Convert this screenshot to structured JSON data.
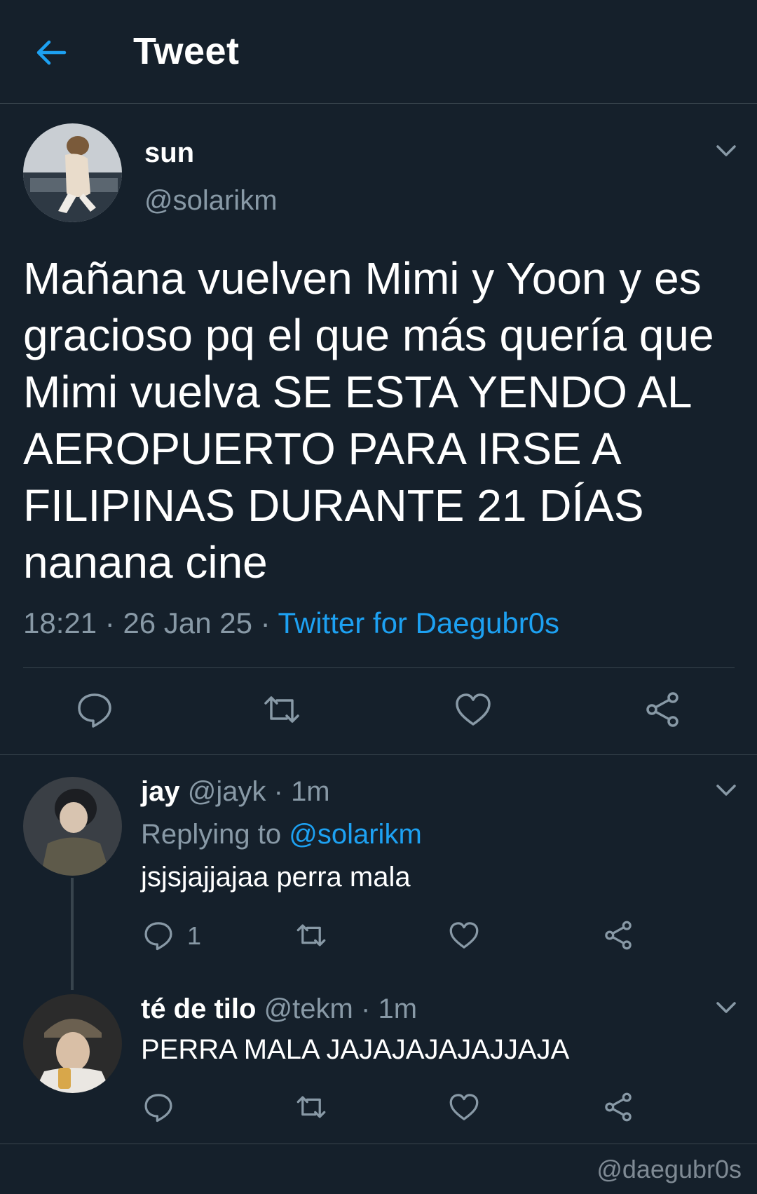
{
  "header": {
    "title": "Tweet",
    "back_icon": "arrow-left-icon"
  },
  "tweet": {
    "name": "sun",
    "handle": "@solarikm",
    "text": "Mañana vuelven Mimi y Yoon y es gracioso pq el que más quería que Mimi vuelva SE ESTA YENDO AL AEROPUERTO PARA IRSE A FILIPINAS DURANTE 21 DÍAS nanana cine",
    "time": "18:21",
    "date": "26 Jan 25",
    "separator": "·",
    "source": "Twitter for Daegubr0s"
  },
  "replies": [
    {
      "name": "jay",
      "handle": "@jayk",
      "time": "1m",
      "replying_label": "Replying to",
      "replying_handle": "@solarikm",
      "text": "jsjsjajjajaa perra mala",
      "reply_count": "1"
    },
    {
      "name": "té de tilo",
      "handle": "@tekm",
      "time": "1m",
      "text": "PERRA MALA JAJAJAJAJAJJAJA"
    }
  ],
  "watermark": "@daegubr0s",
  "colors": {
    "background": "#15202b",
    "accent": "#1da1f2",
    "secondary_text": "#8899a6",
    "divider": "#38444d"
  },
  "icons": [
    "arrow-left-icon",
    "chevron-down-icon",
    "reply-icon",
    "retweet-icon",
    "like-icon",
    "share-icon"
  ]
}
